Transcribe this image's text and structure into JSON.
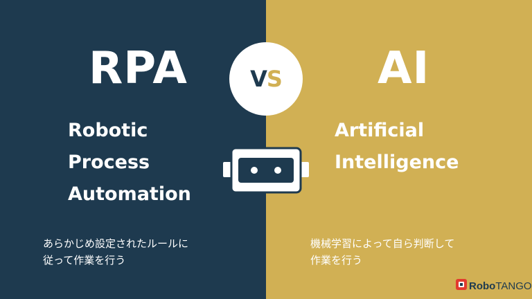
{
  "left": {
    "title": "RPA",
    "subtitle_lines": [
      "Robotic",
      "Process",
      "Automation"
    ],
    "description_lines": [
      "あらかじめ設定されたルールに",
      "従って作業を行う"
    ],
    "background": "#1e3a4f"
  },
  "right": {
    "title": "AI",
    "subtitle_lines": [
      "Artificial",
      "Intelligence"
    ],
    "description_lines": [
      "機械学習によって自ら判断して",
      "作業を行う"
    ],
    "background": "#d1b054"
  },
  "vs": {
    "v": "V",
    "s": "S"
  },
  "robot_icon": "robot-face-icon",
  "brand": {
    "name_bold": "Robo",
    "name_light": "TANGO",
    "icon": "robotango-logo-icon",
    "accent": "#e23b2e"
  }
}
